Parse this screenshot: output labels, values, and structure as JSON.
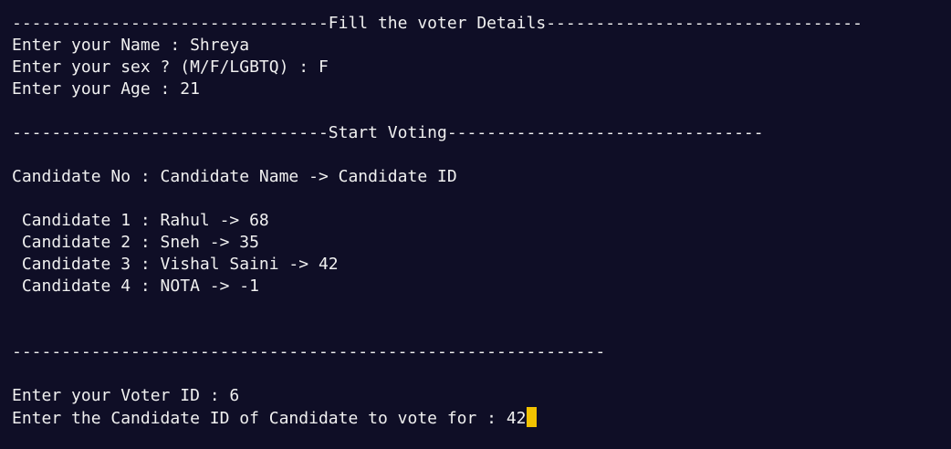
{
  "terminal": {
    "cursor_color": "#f2c200",
    "background_color": "#0f0e26",
    "text_color": "#f0f0f0",
    "lines": [
      "--------------------------------Fill the voter Details--------------------------------",
      "Enter your Name : Shreya",
      "Enter your sex ? (M/F/LGBTQ) : F",
      "Enter your Age : 21",
      "",
      "--------------------------------Start Voting--------------------------------",
      "",
      "Candidate No : Candidate Name -> Candidate ID",
      "",
      " Candidate 1 : Rahul -> 68",
      " Candidate 2 : Sneh -> 35",
      " Candidate 3 : Vishal Saini -> 42",
      " Candidate 4 : NOTA -> -1",
      "",
      "",
      "------------------------------------------------------------",
      "",
      "Enter your Voter ID : 6",
      "Enter the Candidate ID of Candidate to vote for : 42"
    ]
  }
}
